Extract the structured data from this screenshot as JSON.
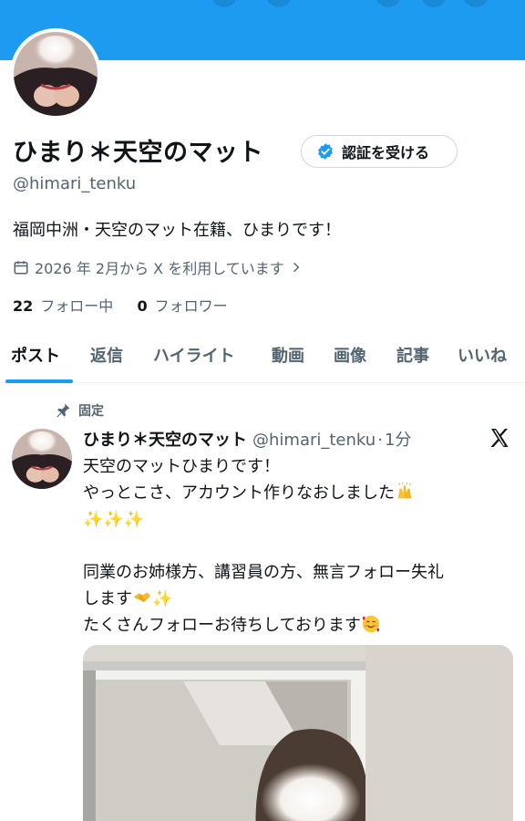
{
  "profile": {
    "display_name": "ひまり＊天空のマット",
    "verify_label": "認証を受ける",
    "handle": "@himari_tenku",
    "bio": "福岡中洲・天空のマット在籍、ひまりです！",
    "joined": "2026 年 2月から X を利用しています",
    "following_count": "22",
    "following_label": "フォロー中",
    "followers_count": "0",
    "followers_label": "フォロワー"
  },
  "tabs": [
    "ポスト",
    "返信",
    "ハイライト",
    "動画",
    "画像",
    "記事",
    "いいね"
  ],
  "pinned_post": {
    "pinned_label": "固定",
    "author_name": "ひまり＊天空のマット",
    "author_handle": "@himari_tenku",
    "separator": "·",
    "time": "1分",
    "lines": [
      "天空のマットひまりです！",
      "やっとこさ、アカウント作りなおしました",
      "同業のお姉様方、講習員の方、無言フォロー失礼",
      "します",
      "たくさんフォローお待ちしております"
    ],
    "sparkles": "✨✨✨"
  },
  "colors": {
    "accent": "#1d9bf0",
    "text": "#0f1419",
    "muted": "#536471",
    "border": "#cfd9de"
  },
  "icons": [
    "verified-badge-icon",
    "calendar-icon",
    "chevron-right-icon",
    "pin-icon",
    "x-logo-icon",
    "raised-hands-emoji",
    "handshake-emoji",
    "smiling-hearts-emoji",
    "sparkles-emoji"
  ]
}
